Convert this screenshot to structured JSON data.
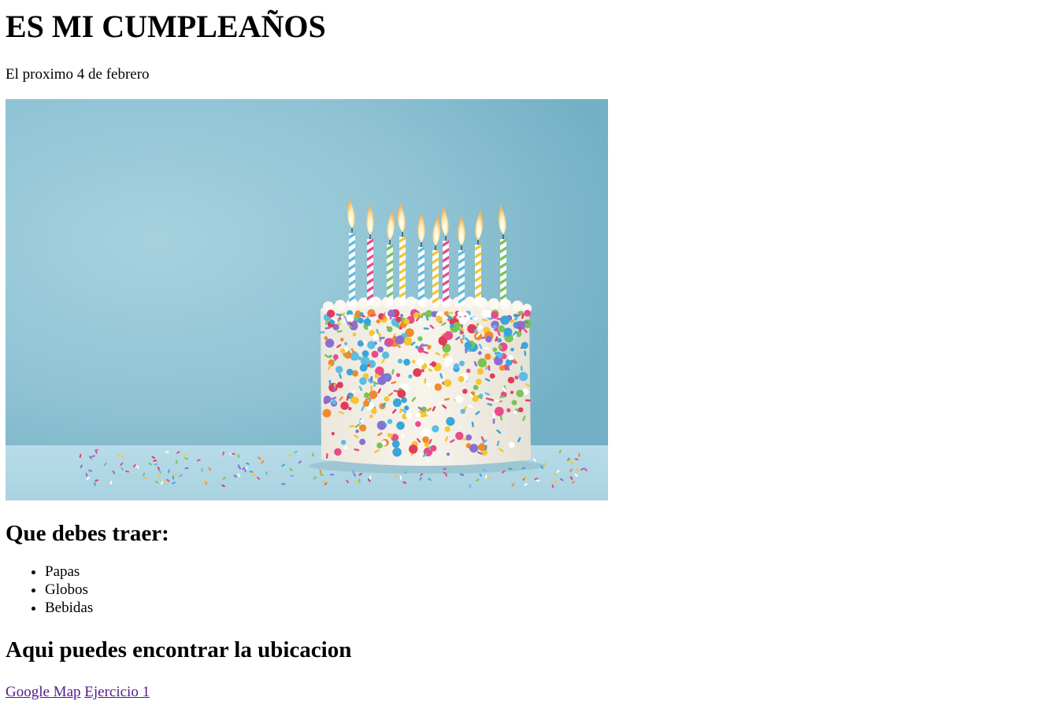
{
  "header": {
    "title": "ES MI CUMPLEAÑOS",
    "subtitle": "El proximo 4 de febrero"
  },
  "image": {
    "alt": "Pastel de cumpleaños con velas y chispas de colores",
    "colors": {
      "background": "#8fc3d4",
      "table": "#bcdce8",
      "cake": "#f3efe6"
    }
  },
  "bring_section": {
    "heading": "Que debes traer:",
    "items": [
      "Papas",
      "Globos",
      "Bebidas"
    ]
  },
  "location_section": {
    "heading": "Aqui puedes encontrar la ubicacion",
    "links": [
      {
        "label": "Google Map"
      },
      {
        "label": "Ejercicio 1"
      }
    ],
    "link_color": "#551a8b"
  }
}
